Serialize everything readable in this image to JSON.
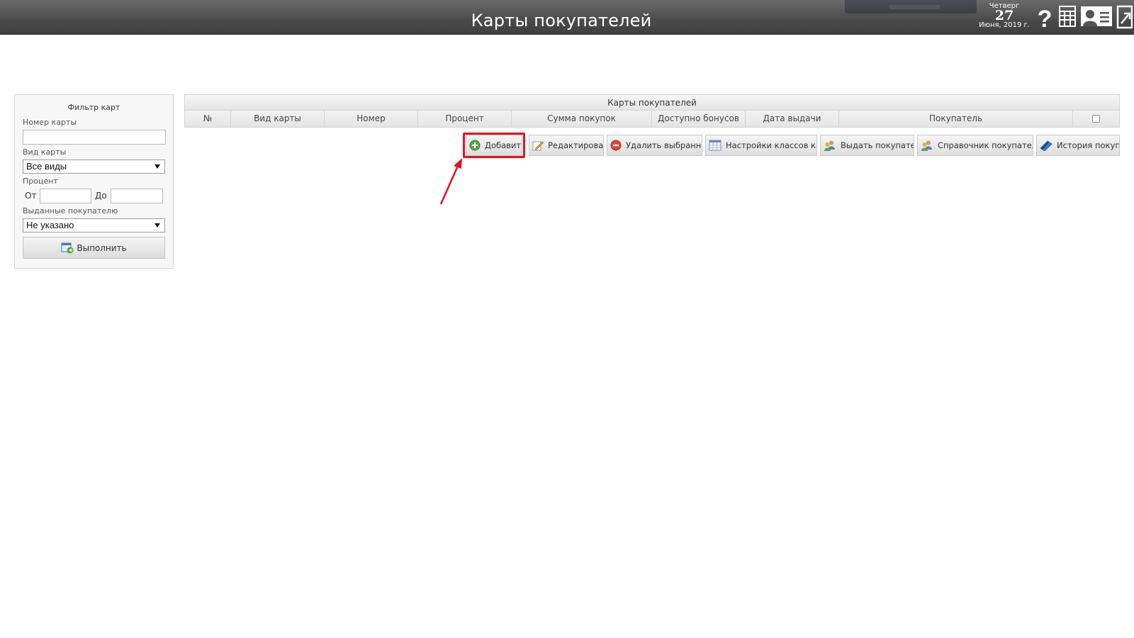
{
  "header": {
    "title": "Карты покупателей",
    "date": {
      "weekday": "Четверг",
      "day": "27",
      "month_year": "Июня, 2019 г."
    },
    "icons": [
      "help-icon",
      "calculator-icon",
      "user-card-icon",
      "exit-icon"
    ]
  },
  "filter": {
    "title": "Фильтр карт",
    "card_number_label": "Номер карты",
    "card_number_value": "",
    "card_type_label": "Вид карты",
    "card_type_selected": "Все виды",
    "percent_label": "Процент",
    "from_label": "От",
    "from_value": "",
    "to_label": "До",
    "to_value": "",
    "issued_label": "Выданные покупателю",
    "issued_selected": "Не указано",
    "run_label": "Выполнить"
  },
  "grid": {
    "caption": "Карты покупателей",
    "columns": [
      "№",
      "Вид карты",
      "Номер",
      "Процент",
      "Сумма покупок",
      "Доступно бонусов",
      "Дата выдачи",
      "Покупатель"
    ]
  },
  "toolbar": {
    "add": "Добавить",
    "edit": "Редактировать",
    "delete_selected": "Удалить выбранные",
    "class_settings": "Настройки классов карт",
    "issue_to_buyer": "Выдать покупателю",
    "buyers_directory": "Справочник покупателей",
    "purchase_history": "История покупок"
  },
  "colors": {
    "header_bg": "#4a4a4a",
    "annotation": "#e8121d"
  }
}
